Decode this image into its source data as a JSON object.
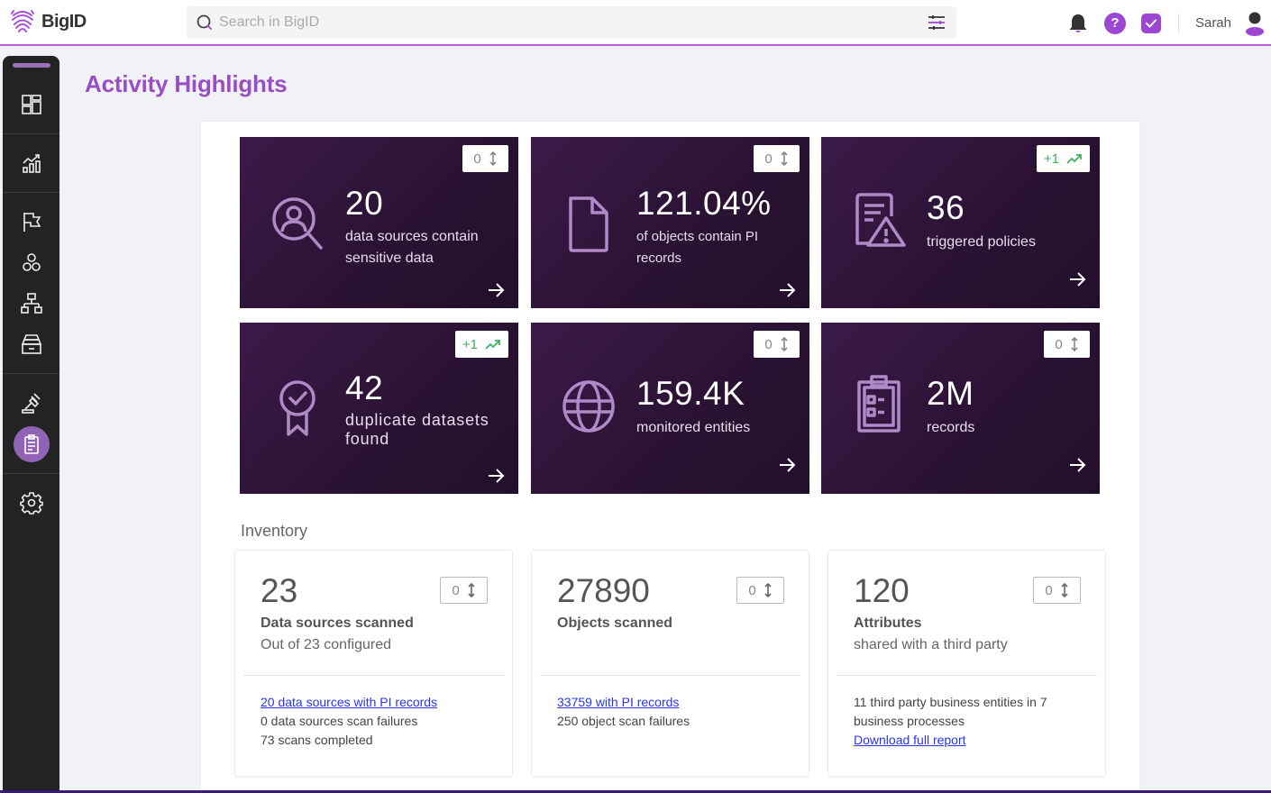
{
  "header": {
    "logo_text": "BigID",
    "search_placeholder": "Search in BigID",
    "username": "Sarah",
    "help_label": "?"
  },
  "sidebar": {
    "items": [
      {
        "name": "dashboard",
        "icon": "dashboard-icon"
      },
      {
        "name": "analytics",
        "icon": "chart-growth-icon"
      },
      {
        "name": "policies",
        "icon": "flag-icon"
      },
      {
        "name": "clusters",
        "icon": "hexagons-icon"
      },
      {
        "name": "hierarchy",
        "icon": "org-chart-icon"
      },
      {
        "name": "inventory",
        "icon": "archive-drawer-icon"
      },
      {
        "name": "compliance",
        "icon": "gavel-icon"
      },
      {
        "name": "reports",
        "icon": "clipboard-icon",
        "active": true
      },
      {
        "name": "settings",
        "icon": "gear-icon"
      }
    ]
  },
  "page": {
    "title": "Activity Highlights"
  },
  "highlights": [
    {
      "value": "20",
      "label": "data sources contain sensitive data",
      "badge": "0",
      "trend": "neutral",
      "icon": "person-search-icon"
    },
    {
      "value": "121.04%",
      "label": "of objects contain PI records",
      "badge": "0",
      "trend": "neutral",
      "icon": "document-icon"
    },
    {
      "value": "36",
      "label": "triggered policies",
      "badge": "+1",
      "trend": "up",
      "icon": "policy-warning-icon"
    },
    {
      "value": "42",
      "label": "duplicate datasets found",
      "badge": "+1",
      "trend": "up",
      "icon": "award-badge-icon"
    },
    {
      "value": "159.4K",
      "label": "monitored entities",
      "badge": "0",
      "trend": "neutral",
      "icon": "globe-icon"
    },
    {
      "value": "2M",
      "label": "records",
      "badge": "0",
      "trend": "neutral",
      "icon": "clipboard-list-icon"
    }
  ],
  "inventory": {
    "title": "Inventory",
    "cards": [
      {
        "value": "23",
        "badge": "0",
        "title": "Data sources scanned",
        "subtitle": "Out of 23 configured",
        "link": "20 data sources with PI records",
        "lines": [
          "0 data sources scan failures",
          "73 scans completed"
        ]
      },
      {
        "value": "27890",
        "badge": "0",
        "title": "Objects scanned",
        "subtitle": "",
        "link": "33759 with PI records",
        "lines": [
          "250 object scan failures"
        ]
      },
      {
        "value": "120",
        "badge": "0",
        "title": "Attributes",
        "subtitle": "shared with a third party",
        "text": "11 third party business entities in 7 business processes",
        "link": "Download full report"
      }
    ]
  },
  "colors": {
    "brand_purple": "#9a4ec4",
    "card_dark": "#2a1232",
    "trend_up": "#3fae58",
    "link": "#2a35e6"
  }
}
